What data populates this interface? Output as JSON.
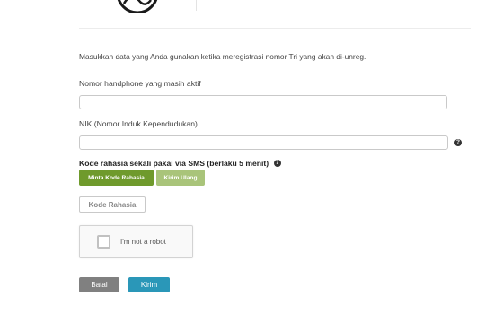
{
  "intro_text": "Masukkan data yang Anda gunakan ketika meregistrasi nomor Tri yang akan di-unreg.",
  "phone_field": {
    "label": "Nomor handphone yang masih aktif",
    "value": ""
  },
  "nik_field": {
    "label": "NIK (Nomor Induk Kependudukan)",
    "value": ""
  },
  "sms_code": {
    "label": "Kode rahasia sekali pakai via SMS (berlaku 5 menit)",
    "request_button": "Minta Kode Rahasia",
    "resend_button": "Kirim Ulang",
    "placeholder": "Kode Rahasia"
  },
  "recaptcha": {
    "label": "I'm not a robot"
  },
  "actions": {
    "cancel": "Batal",
    "submit": "Kirim"
  },
  "icons": {
    "help": "question-circle-icon",
    "logo": "tri-logo-icon"
  },
  "colors": {
    "request_button": "#6f9a2c",
    "resend_button": "#a9c47a",
    "cancel_button": "#808080",
    "submit_button": "#2a97b8"
  }
}
